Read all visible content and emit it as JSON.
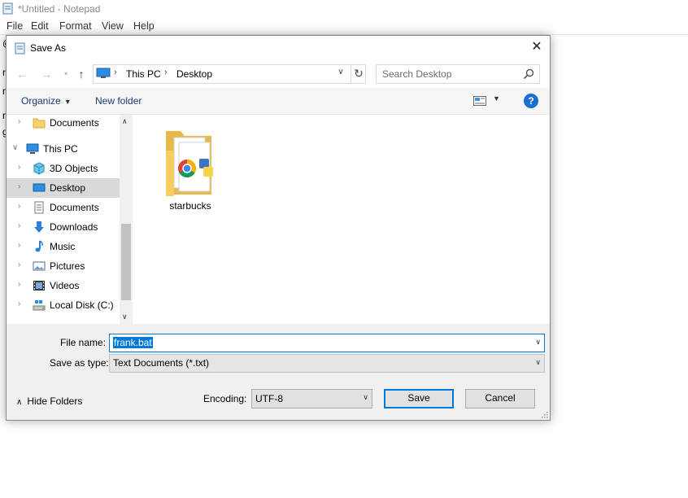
{
  "notepad": {
    "title": "*Untitled - Notepad",
    "menu": [
      "File",
      "Edit",
      "Format",
      "View",
      "Help"
    ],
    "text_fragments": [
      "@",
      "r",
      "r",
      "r",
      "g"
    ]
  },
  "dialog": {
    "title": "Save As",
    "close_glyph": "✕",
    "address": {
      "crumb1": "This PC",
      "crumb2": "Desktop",
      "sep": "›"
    },
    "search": {
      "placeholder": "Search Desktop"
    },
    "toolbar": {
      "organize": "Organize",
      "new_folder": "New folder",
      "help": "?"
    },
    "tree": [
      {
        "label": "Documents",
        "icon": "folder-icon"
      },
      {
        "label": "This PC",
        "icon": "computer-icon"
      },
      {
        "label": "3D Objects",
        "icon": "3d-objects-icon"
      },
      {
        "label": "Desktop",
        "icon": "desktop-icon"
      },
      {
        "label": "Documents",
        "icon": "documents-icon"
      },
      {
        "label": "Downloads",
        "icon": "download-icon"
      },
      {
        "label": "Music",
        "icon": "music-icon"
      },
      {
        "label": "Pictures",
        "icon": "pictures-icon"
      },
      {
        "label": "Videos",
        "icon": "videos-icon"
      },
      {
        "label": "Local Disk (C:)",
        "icon": "disk-icon"
      }
    ],
    "files": [
      {
        "name": "starbucks",
        "icon": "folder-icon"
      }
    ],
    "file_name": {
      "label": "File name:",
      "value": "frank.bat"
    },
    "save_as_type": {
      "label": "Save as type:",
      "value": "Text Documents (*.txt)"
    },
    "hide_folders": "Hide Folders",
    "encoding": {
      "label": "Encoding:",
      "value": "UTF-8"
    },
    "save_button": "Save",
    "cancel_button": "Cancel"
  },
  "colors": {
    "accent": "#0078d7",
    "selection": "#cce8ff",
    "help": "#1c6dd0"
  }
}
